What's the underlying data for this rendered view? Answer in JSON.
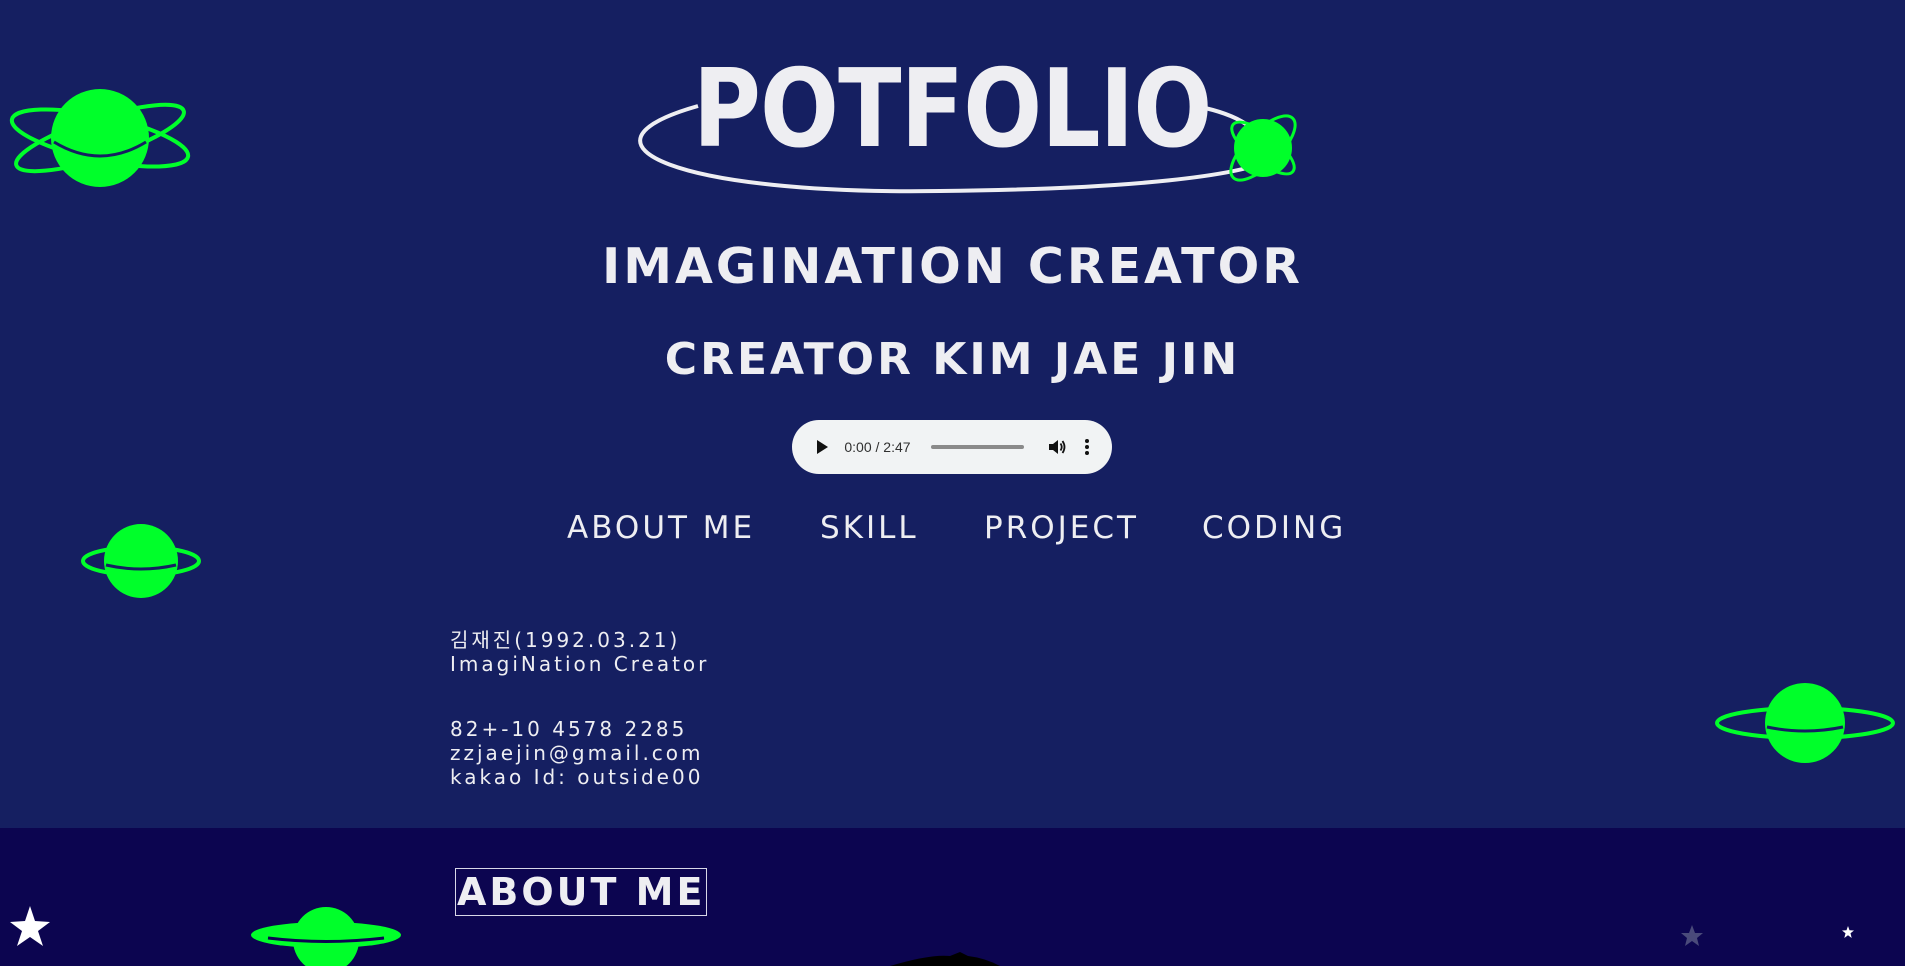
{
  "header": {
    "title": "POTFOLIO",
    "subtitle": "IMAGINATION CREATOR",
    "creator_line": "CREATOR KIM JAE JIN"
  },
  "audio": {
    "time": "0:00 / 2:47",
    "play_icon": "play-icon",
    "volume_icon": "volume-icon",
    "more_icon": "more-vert-icon"
  },
  "nav": {
    "items": [
      {
        "label": "ABOUT ME"
      },
      {
        "label": "SKILL"
      },
      {
        "label": "PROJECT"
      },
      {
        "label": "CODING"
      }
    ]
  },
  "profile": {
    "name_line": "김재진(1992.03.21)",
    "role_line": "ImagiNation Creator",
    "phone": "82+-10 4578 2285",
    "email": "zzjaejin@gmail.com",
    "kakao": "kakao Id: outside00"
  },
  "about": {
    "heading": "ABOUT ME"
  },
  "colors": {
    "hero_bg": "#151f61",
    "about_bg": "#0c0550",
    "planet_green": "#00ff2a",
    "text": "#eeeef2",
    "player_bg": "#f1f3f4"
  }
}
